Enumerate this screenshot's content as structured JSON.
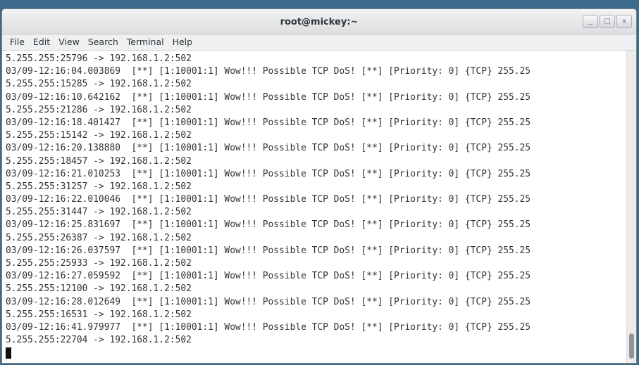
{
  "window": {
    "title": "root@mickey:~",
    "buttons": {
      "minimize": "_",
      "maximize": "□",
      "close": "x"
    }
  },
  "menubar": {
    "items": [
      "File",
      "Edit",
      "View",
      "Search",
      "Terminal",
      "Help"
    ]
  },
  "terminal": {
    "lines": [
      "5.255.255:25796 -> 192.168.1.2:502",
      "03/09-12:16:04.003869  [**] [1:10001:1] Wow!!! Possible TCP DoS! [**] [Priority: 0] {TCP} 255.25",
      "5.255.255:15285 -> 192.168.1.2:502",
      "03/09-12:16:10.642162  [**] [1:10001:1] Wow!!! Possible TCP DoS! [**] [Priority: 0] {TCP} 255.25",
      "5.255.255:21286 -> 192.168.1.2:502",
      "03/09-12:16:18.401427  [**] [1:10001:1] Wow!!! Possible TCP DoS! [**] [Priority: 0] {TCP} 255.25",
      "5.255.255:15142 -> 192.168.1.2:502",
      "03/09-12:16:20.138880  [**] [1:10001:1] Wow!!! Possible TCP DoS! [**] [Priority: 0] {TCP} 255.25",
      "5.255.255:18457 -> 192.168.1.2:502",
      "03/09-12:16:21.010253  [**] [1:10001:1] Wow!!! Possible TCP DoS! [**] [Priority: 0] {TCP} 255.25",
      "5.255.255:31257 -> 192.168.1.2:502",
      "03/09-12:16:22.010046  [**] [1:10001:1] Wow!!! Possible TCP DoS! [**] [Priority: 0] {TCP} 255.25",
      "5.255.255:31447 -> 192.168.1.2:502",
      "03/09-12:16:25.831697  [**] [1:10001:1] Wow!!! Possible TCP DoS! [**] [Priority: 0] {TCP} 255.25",
      "5.255.255:26387 -> 192.168.1.2:502",
      "03/09-12:16:26.037597  [**] [1:10001:1] Wow!!! Possible TCP DoS! [**] [Priority: 0] {TCP} 255.25",
      "5.255.255:25933 -> 192.168.1.2:502",
      "03/09-12:16:27.059592  [**] [1:10001:1] Wow!!! Possible TCP DoS! [**] [Priority: 0] {TCP} 255.25",
      "5.255.255:12100 -> 192.168.1.2:502",
      "03/09-12:16:28.012649  [**] [1:10001:1] Wow!!! Possible TCP DoS! [**] [Priority: 0] {TCP} 255.25",
      "5.255.255:16531 -> 192.168.1.2:502",
      "03/09-12:16:41.979977  [**] [1:10001:1] Wow!!! Possible TCP DoS! [**] [Priority: 0] {TCP} 255.25",
      "5.255.255:22704 -> 192.168.1.2:502"
    ]
  }
}
